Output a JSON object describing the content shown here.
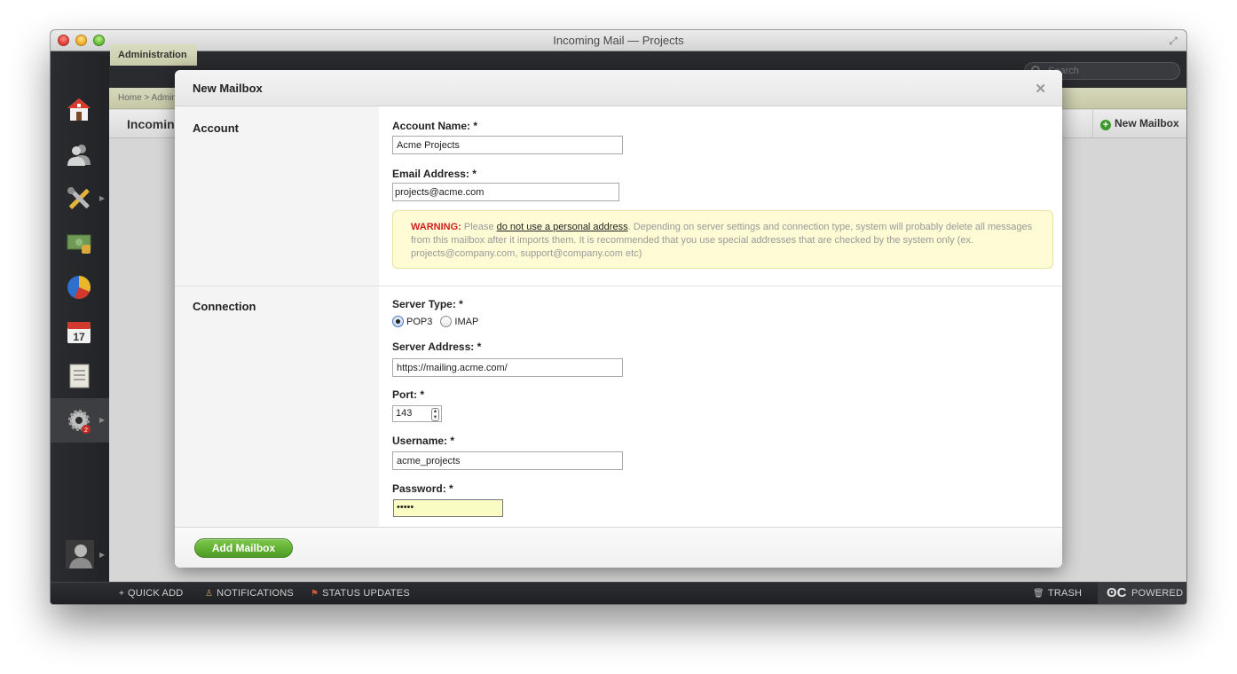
{
  "window": {
    "title": "Incoming Mail — Projects"
  },
  "topbar": {
    "admin_tab": "Administration",
    "search_placeholder": "Search"
  },
  "breadcrumb": {
    "home": "Home",
    "admin": "Administration"
  },
  "section": {
    "title": "Incoming Mail",
    "new_mailbox_label": "New Mailbox"
  },
  "sidebar": {
    "items": [
      "home-icon",
      "people-icon",
      "tools-icon",
      "money-icon",
      "reports-icon",
      "calendar-icon",
      "notes-icon",
      "settings-icon",
      "user-avatar"
    ],
    "calendar_day": "17",
    "settings_badge": "2"
  },
  "modal": {
    "title": "New Mailbox",
    "account": {
      "section_label": "Account",
      "name_label": "Account Name: *",
      "name_value": "Acme Projects",
      "email_label": "Email Address: *",
      "email_value": "projects@acme.com",
      "warning_strong": "WARNING:",
      "warning_pre": " Please ",
      "warning_link": "do not use a personal address",
      "warning_post": ". Depending on server settings and connection type, system will probably delete all messages from this mailbox after it imports them. It is recommended that you use special addresses that are checked by the system only (ex. projects@company.com, support@company.com etc)"
    },
    "connection": {
      "section_label": "Connection",
      "server_type_label": "Server Type: *",
      "options": [
        "POP3",
        "IMAP"
      ],
      "selected": "POP3",
      "server_address_label": "Server Address: *",
      "server_address_value": "https://mailing.acme.com/",
      "port_label": "Port: *",
      "port_value": "143",
      "username_label": "Username: *",
      "username_value": "acme_projects",
      "password_label": "Password: *",
      "password_value": "•••••"
    },
    "submit_label": "Add Mailbox"
  },
  "bottombar": {
    "quick_add": "QUICK ADD",
    "notifications": "NOTIFICATIONS",
    "status_updates": "STATUS UPDATES",
    "trash": "TRASH",
    "powered": "POWERED"
  }
}
